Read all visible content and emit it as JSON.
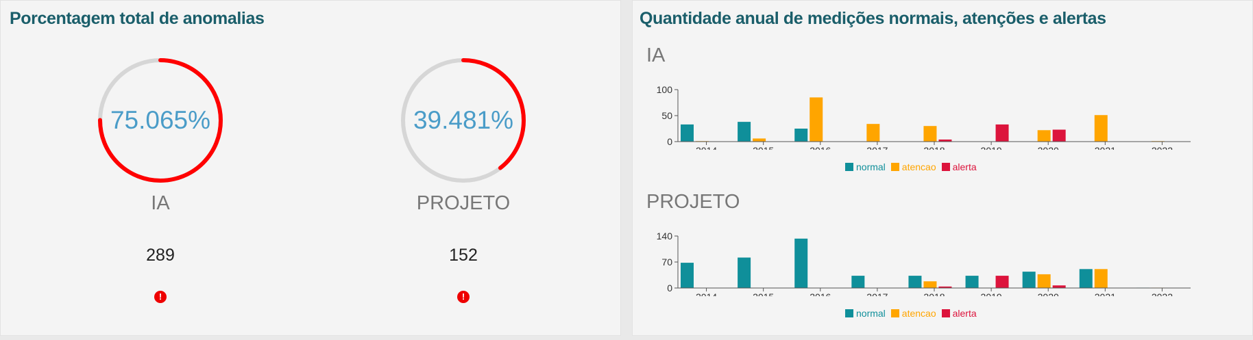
{
  "colors": {
    "title": "#1a5e6a",
    "gauge_value": "#4a9cc8",
    "gauge_track": "#d6d6d6",
    "gauge_fill": "#ff0000",
    "axis": "#555555"
  },
  "left_panel": {
    "title": "Porcentagem total de anomalias",
    "gauges": [
      {
        "value_text": "75.065%",
        "fraction": 0.75065,
        "label": "IA",
        "count": "289",
        "icon": "alert-circle-icon",
        "icon_glyph": "!"
      },
      {
        "value_text": "39.481%",
        "fraction": 0.39481,
        "label": "PROJETO",
        "count": "152",
        "icon": "alert-circle-icon",
        "icon_glyph": "!"
      }
    ]
  },
  "right_panel": {
    "title": "Quantidade anual de medições normais, atenções e alertas"
  },
  "chart_data": [
    {
      "type": "bar",
      "title": "IA",
      "categories": [
        "2014",
        "2015",
        "2016",
        "2017",
        "2018",
        "2019",
        "2020",
        "2021",
        "2022"
      ],
      "yticks": [
        0,
        50,
        100
      ],
      "ylim": [
        0,
        100
      ],
      "series": [
        {
          "name": "normal",
          "color": "#0f8f9a",
          "values": [
            33,
            38,
            25,
            0,
            0,
            0,
            0,
            0,
            0
          ]
        },
        {
          "name": "atencao",
          "color": "#ffa500",
          "values": [
            1,
            6,
            85,
            34,
            30,
            0,
            22,
            51,
            1
          ]
        },
        {
          "name": "alerta",
          "color": "#dc143c",
          "values": [
            0,
            0,
            0,
            0,
            4,
            33,
            23,
            0,
            0
          ]
        }
      ],
      "legend": "bottom-center"
    },
    {
      "type": "bar",
      "title": "PROJETO",
      "categories": [
        "2014",
        "2015",
        "2016",
        "2017",
        "2018",
        "2019",
        "2020",
        "2021",
        "2022"
      ],
      "yticks": [
        0,
        70,
        140
      ],
      "ylim": [
        0,
        140
      ],
      "series": [
        {
          "name": "normal",
          "color": "#0f8f9a",
          "values": [
            68,
            82,
            133,
            33,
            33,
            33,
            44,
            51,
            1
          ]
        },
        {
          "name": "atencao",
          "color": "#ffa500",
          "values": [
            0,
            0,
            0,
            0,
            18,
            0,
            37,
            51,
            1
          ]
        },
        {
          "name": "alerta",
          "color": "#dc143c",
          "values": [
            0,
            0,
            0,
            0,
            4,
            33,
            7,
            0,
            0
          ]
        }
      ],
      "legend": "bottom-center"
    }
  ]
}
